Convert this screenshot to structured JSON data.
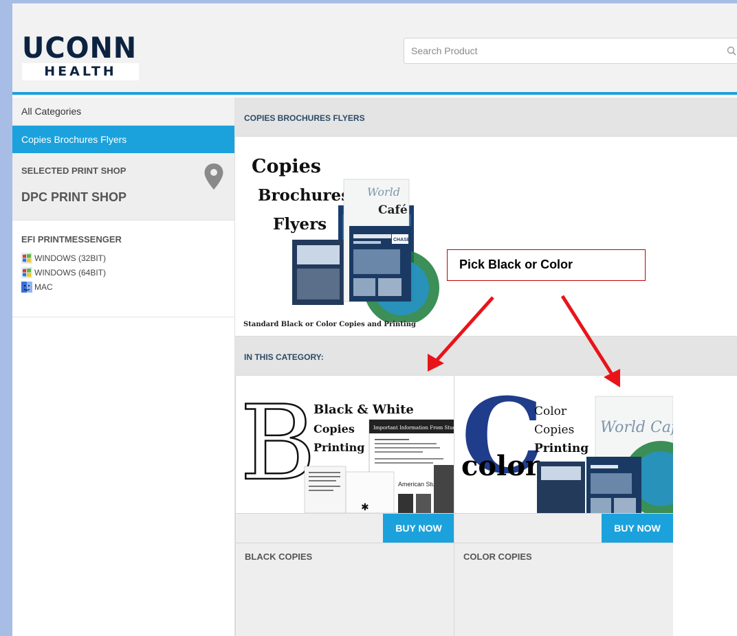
{
  "header": {
    "logo_top": "UCONN",
    "logo_bottom": "HEALTH",
    "search_placeholder": "Search Product"
  },
  "sidebar": {
    "all_categories": "All Categories",
    "active_category": "Copies Brochures Flyers",
    "print_shop_label": "SELECTED PRINT SHOP",
    "print_shop_name": "DPC PRINT SHOP",
    "efi_title": "EFI PRINTMESSENGER",
    "downloads": [
      {
        "label": "WINDOWS (32BIT)",
        "icon": "windows-icon"
      },
      {
        "label": "WINDOWS (64BIT)",
        "icon": "windows-icon"
      },
      {
        "label": "MAC",
        "icon": "mac-icon"
      }
    ]
  },
  "main": {
    "category_title": "COPIES BROCHURES FLYERS",
    "hero_lines": [
      "Copies",
      "Brochures",
      "Flyers"
    ],
    "hero_caption": "Standard Black or Color Copies and Printing",
    "section_title": "IN THIS CATEGORY:",
    "products": [
      {
        "name": "BLACK COPIES",
        "buy_label": "BUY NOW",
        "img_letter": "B",
        "img_lines": [
          "Black & White",
          "Copies",
          "Printing"
        ],
        "img_doc_title": "Important Information From Student Health Services",
        "img_doc_word": "American Studies"
      },
      {
        "name": "COLOR COPIES",
        "buy_label": "BUY NOW",
        "img_letter": "C",
        "img_word": "color",
        "img_lines": [
          "Color",
          "Copies",
          "Printing"
        ],
        "img_flyer": "World Caf"
      }
    ]
  },
  "hero_flyer": {
    "script": "World",
    "cafe": "Café",
    "chase": "CHASE"
  },
  "annotation": {
    "callout_text": "Pick Black or Color",
    "arrow_color": "#e8141a"
  },
  "colors": {
    "accent": "#1ba2dc",
    "background": "#a7bde6",
    "logo": "#0c2340"
  }
}
